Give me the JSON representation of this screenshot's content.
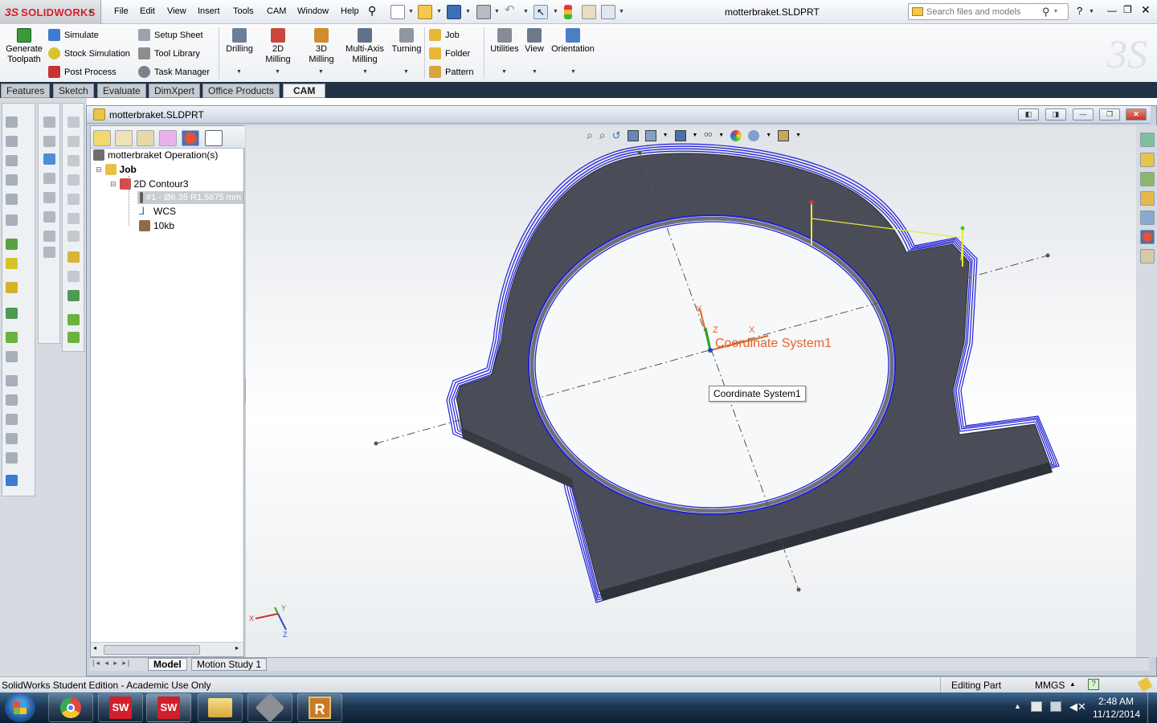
{
  "app": {
    "logo_ds": "3S",
    "logo_text": "SOLIDWORKS",
    "document_title": "motterbraket.SLDPRT"
  },
  "menu": [
    "File",
    "Edit",
    "View",
    "Insert",
    "Tools",
    "CAM",
    "Window",
    "Help"
  ],
  "search": {
    "placeholder": "Search files and models"
  },
  "help_label": "?",
  "commands": {
    "generate": [
      "Generate",
      "Toolpath"
    ],
    "simulate": "Simulate",
    "stock_simulation": "Stock Simulation",
    "post_process": "Post Process",
    "setup_sheet": "Setup Sheet",
    "tool_library": "Tool Library",
    "task_manager": "Task Manager",
    "drilling": "Drilling",
    "milling_2d": "2D Milling",
    "milling_3d": "3D Milling",
    "multi_axis": [
      "Multi-Axis",
      "Milling"
    ],
    "turning": "Turning",
    "job": "Job",
    "folder": "Folder",
    "pattern": "Pattern",
    "utilities": "Utilities",
    "view": "View",
    "orientation": "Orientation"
  },
  "tabs": [
    "Features",
    "Sketch",
    "Evaluate",
    "DimXpert",
    "Office Products",
    "CAM"
  ],
  "active_tab": "CAM",
  "document_window": {
    "title": "motterbraket.SLDPRT"
  },
  "feature_tree": {
    "root": "motterbraket Operation(s)",
    "job": "Job",
    "contour": "2D Contour3",
    "tool": "#1 - Ø6.35 R1.5875 mm",
    "wcs": "WCS",
    "stock": "10kb"
  },
  "viewport": {
    "coordinate_label": "Coordinate System1",
    "tooltip": "Coordinate System1",
    "axis_x": "X",
    "axis_y": "Y",
    "axis_z": "Z",
    "triad_x": "X",
    "triad_y": "Y",
    "triad_z": "Z"
  },
  "bottom_tabs": [
    "Model",
    "Motion Study 1"
  ],
  "status": {
    "left": "SolidWorks Student Edition - Academic Use Only",
    "mode": "Editing Part",
    "units": "MMGS"
  },
  "taskbar": {
    "time": "2:48 AM",
    "date": "11/12/2014",
    "sw1": "SW",
    "sw2": "SW",
    "ribbon_app": "R"
  },
  "colors": {
    "toolpath": "#1f1fd8",
    "part": "#4a4d57",
    "accent_red": "#d1202b",
    "taskbar": "#1c3550"
  }
}
